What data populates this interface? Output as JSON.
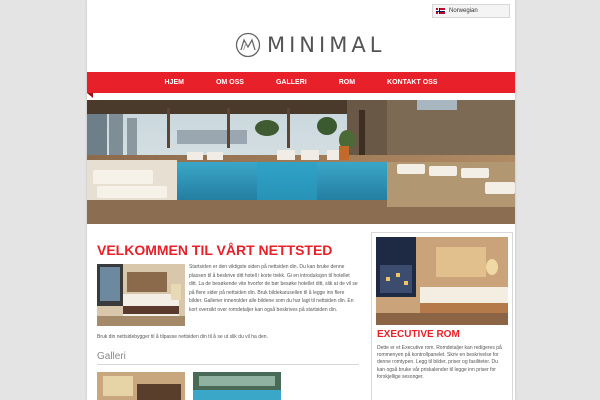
{
  "language": {
    "selected": "Norwegian",
    "icon": "norway-flag-icon"
  },
  "brand": {
    "logo_text": "MINIMAL",
    "icon": "minimal-logo-icon"
  },
  "nav": {
    "items": [
      {
        "label": "HJEM"
      },
      {
        "label": "OM OSS"
      },
      {
        "label": "GALLERI"
      },
      {
        "label": "ROM"
      },
      {
        "label": "KONTAKT OSS"
      }
    ]
  },
  "colors": {
    "accent": "#e8202a",
    "background": "#e4e4e4"
  },
  "welcome": {
    "title": "VELKOMMEN TIL VÅRT NETTSTED",
    "body": "Startsiden er den viktigste siden på nettsiden din. Du kan bruke denne plassen til å beskrive ditt hotell i korte trekk. Gi en introduksjon til hotellet ditt. La de besøkende vite hvorfor de bør besøke hotellet ditt, slik at de vil se på flere sider på nettsiden din. Bruk bildekarusellen til å legge inn flere bilder. Gallerier innenolder alle bildene som du har lagt til nettsiden din. En kort oversikt over romdetaljer kan også beskrives på startsiden din.",
    "tail": "Bruk din nettsidebygger til å tilpasse nettsiden din til å se ut slik du vil ha den."
  },
  "gallery": {
    "title": "Galleri"
  },
  "sidebar": {
    "title": "EXECUTIVE ROM",
    "body": "Dette er et Executive rom. Romdetaljer kan redigeres på rommenyen på kontrollpanelet. Skriv en beskrivelse for denne romtypen. Legg til bilder, priser og fasiliteter. Du kan også bruke vår priskalender til legge inn priser for forskjellige sesonger."
  }
}
